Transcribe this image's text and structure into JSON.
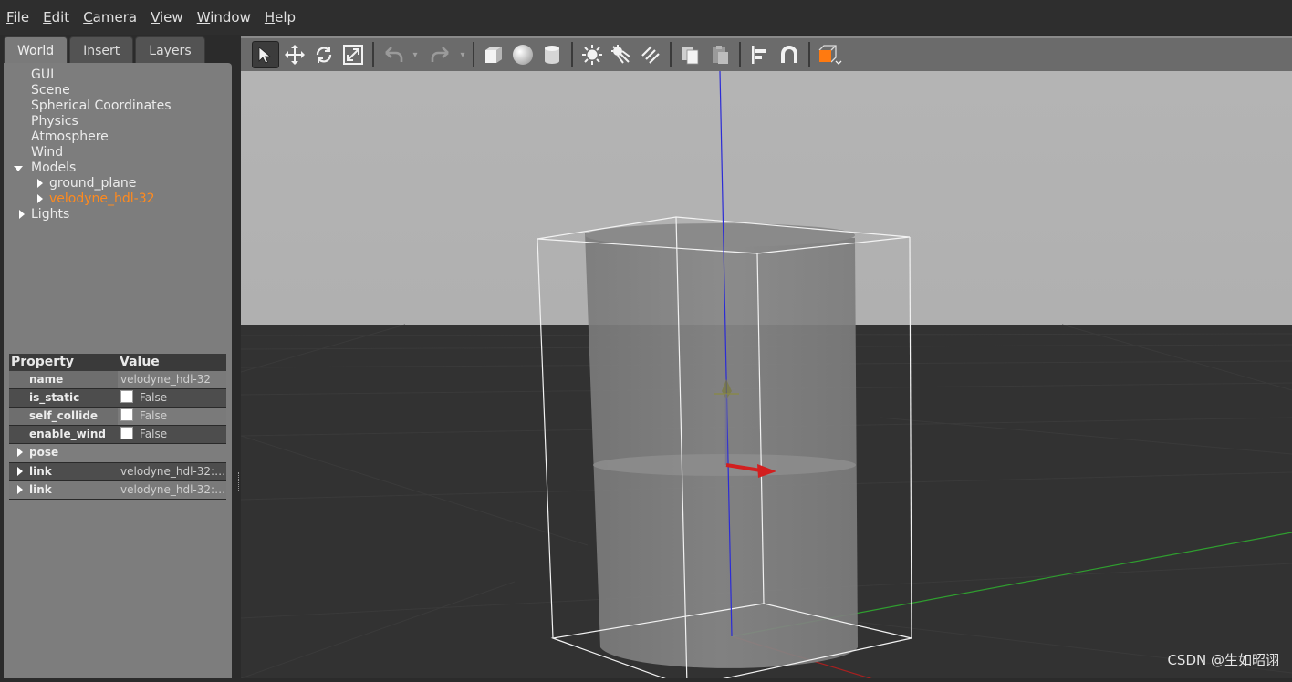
{
  "menubar": {
    "items": [
      {
        "mnemonic": "F",
        "rest": "ile"
      },
      {
        "mnemonic": "E",
        "rest": "dit"
      },
      {
        "mnemonic": "C",
        "rest": "amera"
      },
      {
        "mnemonic": "V",
        "rest": "iew"
      },
      {
        "mnemonic": "W",
        "rest": "indow"
      },
      {
        "mnemonic": "H",
        "rest": "elp"
      }
    ]
  },
  "tabs": [
    "World",
    "Insert",
    "Layers"
  ],
  "tree": {
    "gui": "GUI",
    "scene": "Scene",
    "spherical": "Spherical Coordinates",
    "physics": "Physics",
    "atmosphere": "Atmosphere",
    "wind": "Wind",
    "models": "Models",
    "ground_plane": "ground_plane",
    "velodyne": "velodyne_hdl-32",
    "lights": "Lights"
  },
  "properties": {
    "header_property": "Property",
    "header_value": "Value",
    "name_label": "name",
    "name_value": "velodyne_hdl-32",
    "is_static_label": "is_static",
    "is_static_value": "False",
    "self_collide_label": "self_collide",
    "self_collide_value": "False",
    "enable_wind_label": "enable_wind",
    "enable_wind_value": "False",
    "pose_label": "pose",
    "link1_label": "link",
    "link1_value": "velodyne_hdl-32:…",
    "link2_label": "link",
    "link2_value": "velodyne_hdl-32:…"
  },
  "toolbar_icons": [
    "select-arrow",
    "translate",
    "rotate",
    "scale",
    "undo",
    "undo-menu",
    "redo",
    "redo-menu",
    "box",
    "sphere",
    "cylinder",
    "point-light",
    "spot-light",
    "directional-light",
    "copy",
    "paste",
    "align",
    "snap",
    "view-angle"
  ],
  "colors": {
    "selection": "#ff8a1e",
    "x_axis": "#d21f1f",
    "y_axis": "#3fb33f",
    "z_axis": "#2a2ad6"
  },
  "watermark": "CSDN @生如昭诩"
}
